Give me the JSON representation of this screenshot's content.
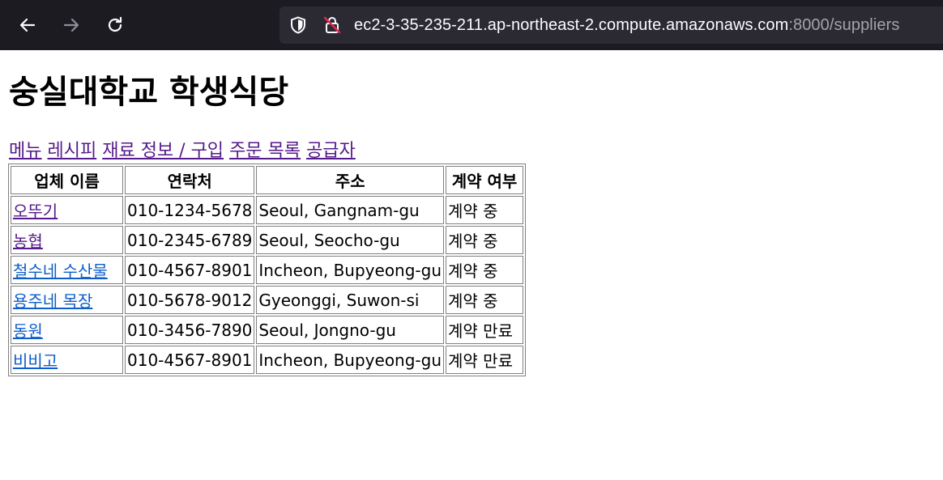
{
  "browser": {
    "url_host": "ec2-3-35-235-211.ap-northeast-2.compute.amazonaws.com",
    "url_rest": ":8000/suppliers"
  },
  "page": {
    "title": "숭실대학교 학생식당",
    "nav": [
      "메뉴",
      "레시피",
      "재료 정보 / 구입",
      "주문 목록",
      "공급자"
    ]
  },
  "table": {
    "headers": [
      "업체 이름",
      "연락처",
      "주소",
      "계약 여부"
    ],
    "rows": [
      {
        "name": "오뚜기",
        "phone": "010-1234-5678",
        "address": "Seoul, Gangnam-gu",
        "contract": "계약 중",
        "visited": true
      },
      {
        "name": "농협",
        "phone": "010-2345-6789",
        "address": "Seoul, Seocho-gu",
        "contract": "계약 중",
        "visited": true
      },
      {
        "name": "철수네 수산물",
        "phone": "010-4567-8901",
        "address": "Incheon, Bupyeong-gu",
        "contract": "계약 중",
        "visited": false
      },
      {
        "name": "용주네 목장",
        "phone": "010-5678-9012",
        "address": "Gyeonggi, Suwon-si",
        "contract": "계약 중",
        "visited": false
      },
      {
        "name": "동원",
        "phone": "010-3456-7890",
        "address": "Seoul, Jongno-gu",
        "contract": "계약 만료",
        "visited": false
      },
      {
        "name": "비비고",
        "phone": "010-4567-8901",
        "address": "Incheon, Bupyeong-gu",
        "contract": "계약 만료",
        "visited": false
      }
    ]
  }
}
